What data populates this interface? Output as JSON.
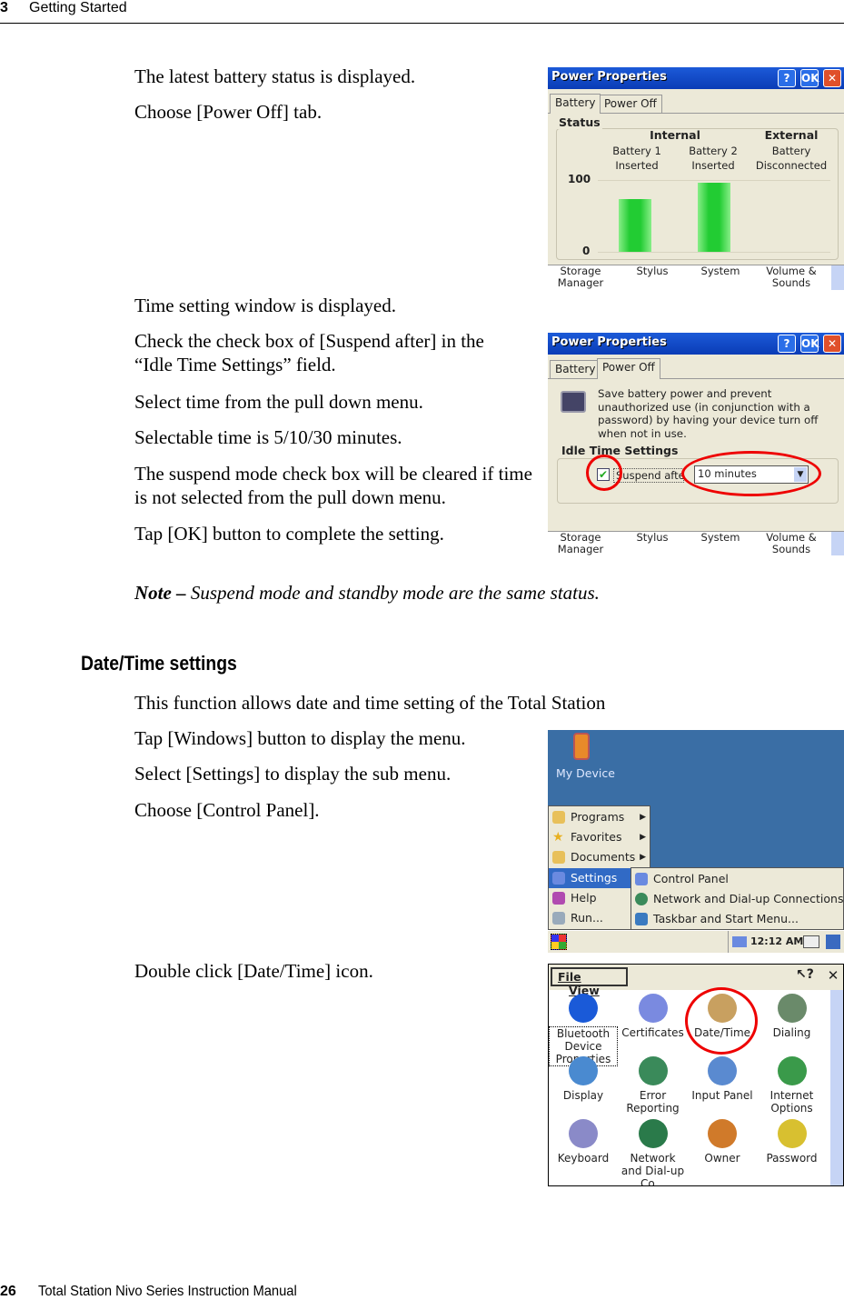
{
  "header": {
    "chapter": "3",
    "title": "Getting Started"
  },
  "footer": {
    "page": "26",
    "title": "Total Station Nivo Series Instruction Manual"
  },
  "paragraphs": {
    "p1": "The latest battery status is displayed.",
    "p2": "Choose [Power Off] tab.",
    "p3": "Time setting window is displayed.",
    "p4": "Check the check box of [Suspend after] in the “Idle Time Settings” field.",
    "p5": "Select time from the pull down menu.",
    "p6": "Selectable time is 5/10/30 minutes.",
    "p7": "The suspend mode check box will be cleared if time is not selected from the pull down menu.",
    "p8": "Tap [OK] button to complete the setting.",
    "note_lead": "Note –",
    "note": " Suspend mode and standby mode are the same status.",
    "section": "Date/Time settings",
    "p9": "This function allows date and time setting of the Total Station",
    "p10": "Tap [Windows] button to display the menu.",
    "p11": "Select [Settings] to display the sub menu.",
    "p12": "Choose [Control Panel].",
    "p13": "Double click [Date/Time] icon."
  },
  "power_window": {
    "title": "Power Properties",
    "help": "?",
    "ok": "OK",
    "close": "✕",
    "tabs": [
      "Battery",
      "Power Off"
    ],
    "status_label": "Status",
    "internal": "Internal",
    "external": "External",
    "batteries": [
      {
        "name": "Battery 1",
        "state": "Inserted",
        "level": 73
      },
      {
        "name": "Battery 2",
        "state": "Inserted",
        "level": 96
      },
      {
        "name": "Battery",
        "state": "Disconnected"
      }
    ],
    "axis_max": "100",
    "axis_min": "0",
    "description": "Save battery power and prevent unauthorized use (in conjunction with a password) by having your device turn off when not in use.",
    "idle_label": "Idle Time Settings",
    "suspend_label": "Suspend after",
    "suspend_checked": true,
    "suspend_value": "10 minutes",
    "bottom_items": [
      "Storage Manager",
      "Stylus",
      "System",
      "Volume & Sounds"
    ],
    "highlight_color": "#e00000",
    "bar_color": "#22cc33"
  },
  "desktop": {
    "icon_label": "My Device",
    "menu": [
      "Programs",
      "Favorites",
      "Documents",
      "Settings",
      "Help",
      "Run..."
    ],
    "submenu": [
      "Control Panel",
      "Network and Dial-up Connections",
      "Taskbar and Start Menu..."
    ],
    "clock": "12:12 AM",
    "bg_color": "#3a6ea5"
  },
  "control_panel": {
    "menu": [
      "File",
      "View"
    ],
    "items": [
      "Bluetooth Device Properties",
      "Certificates",
      "Date/Time",
      "Dialing",
      "Display",
      "Error Reporting",
      "Input Panel",
      "Internet Options",
      "Keyboard",
      "Network and Dial-up Co...",
      "Owner",
      "Password"
    ]
  }
}
